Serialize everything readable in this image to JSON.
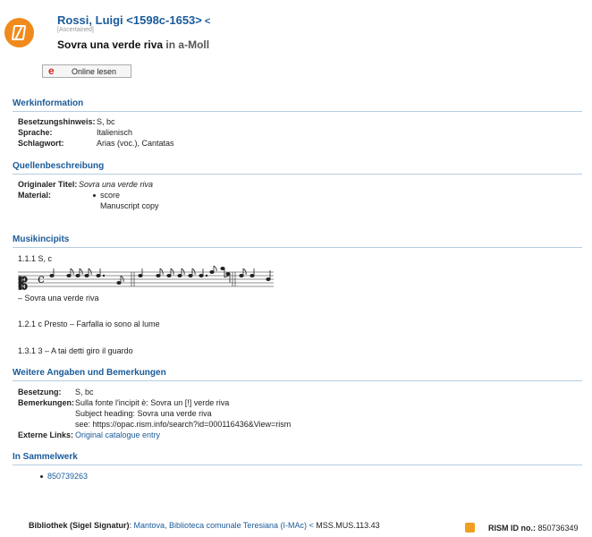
{
  "header": {
    "author": "Rossi, Luigi <1598c-1653>",
    "ascertained": "[Ascertained]",
    "title_main": "Sovra una verde riva",
    "title_key": "in a-Moll",
    "online_button": "Online lesen",
    "online_icon": "e"
  },
  "werkinformation": {
    "heading": "Werkinformation",
    "rows": [
      {
        "label": "Besetzungshinweis:",
        "value": "S, bc"
      },
      {
        "label": "Sprache:",
        "value": "Italienisch"
      },
      {
        "label": "Schlagwort:",
        "value": "Arias (voc.), Cantatas"
      }
    ]
  },
  "quellen": {
    "heading": "Quellenbeschreibung",
    "original_label": "Originaler Titel:",
    "original_value": "Sovra una verde riva",
    "material_label": "Material:",
    "material_items": [
      "score",
      "Manuscript copy"
    ]
  },
  "musikincipits": {
    "heading": "Musikincipits",
    "items": [
      {
        "id": "1.1.1 S, c",
        "text": "– Sovra una verde riva"
      },
      {
        "id": "1.2.1 c Presto – Farfalla io sono al lume",
        "text": ""
      },
      {
        "id": "1.3.1 3  – A tai detti giro il guardo",
        "text": ""
      }
    ]
  },
  "weitere": {
    "heading": "Weitere Angaben und Bemerkungen",
    "besetzung_label": "Besetzung:",
    "besetzung_value": "S, bc",
    "bemerkungen_label": "Bemerkungen:",
    "bemerkungen_lines": [
      "Sulla fonte l'incipit è: Sovra un [!] verde riva",
      "Subject heading: Sovra una verde riva",
      "see: https://opac.rism.info/search?id=000116436&View=rism"
    ],
    "externe_label": "Externe Links:",
    "externe_value": "Original catalogue entry"
  },
  "sammelwerk": {
    "heading": "In Sammelwerk",
    "items": [
      "850739263"
    ]
  },
  "footer": {
    "bibliothek_label": "Bibliothek (Sigel Signatur)",
    "bibliothek_link": "Mantova, Biblioteca comunale Teresiana (I-MAc)",
    "signatur": "MSS.MUS.113.43",
    "rism_label": "RISM ID no.:",
    "rism_value": "850736349"
  },
  "colors": {
    "accent": "#1a5b9a",
    "logo": "#f08a1c",
    "rule": "#b7cde0"
  }
}
